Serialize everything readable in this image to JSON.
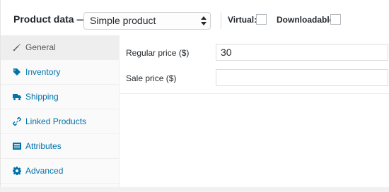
{
  "header": {
    "title": "Product data —",
    "product_type": "Simple product",
    "virtual_label": "Virtual:",
    "downloadable_label": "Downloadable:"
  },
  "tabs": [
    {
      "label": "General",
      "icon": "wrench-icon",
      "active": true
    },
    {
      "label": "Inventory",
      "icon": "tag-icon",
      "active": false
    },
    {
      "label": "Shipping",
      "icon": "truck-icon",
      "active": false
    },
    {
      "label": "Linked Products",
      "icon": "link-icon",
      "active": false
    },
    {
      "label": "Attributes",
      "icon": "list-icon",
      "active": false
    },
    {
      "label": "Advanced",
      "icon": "gear-icon",
      "active": false
    }
  ],
  "general": {
    "regular_price_label": "Regular price ($)",
    "regular_price_value": "30",
    "sale_price_label": "Sale price ($)",
    "sale_price_value": ""
  },
  "colors": {
    "link": "#0073aa",
    "active_tab_bg": "#eeeeee",
    "text": "#23282d"
  }
}
